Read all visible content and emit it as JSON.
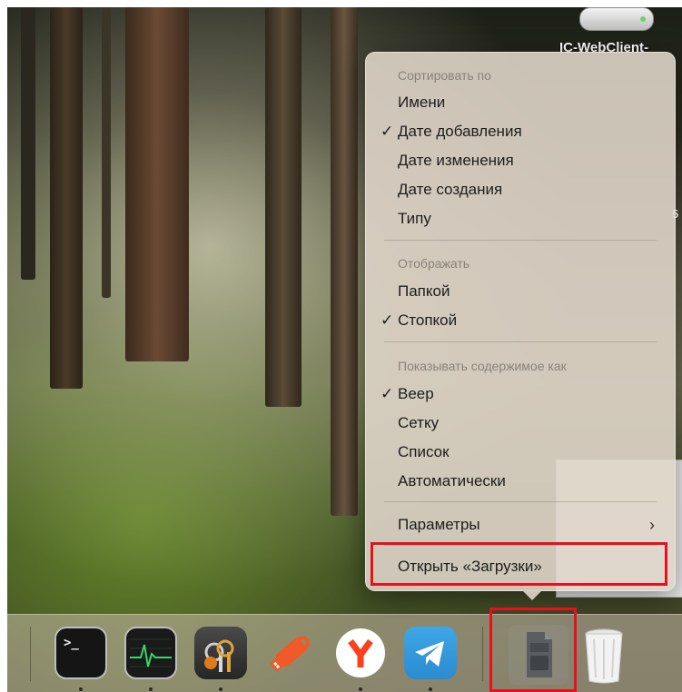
{
  "desktop": {
    "drive_label": "IC-WebClient-",
    "edge_glyph": "5"
  },
  "context_menu": {
    "sort_header": "Сортировать по",
    "sort_items": [
      {
        "label": "Имени",
        "checked": false
      },
      {
        "label": "Дате добавления",
        "checked": true
      },
      {
        "label": "Дате изменения",
        "checked": false
      },
      {
        "label": "Дате создания",
        "checked": false
      },
      {
        "label": "Типу",
        "checked": false
      }
    ],
    "display_header": "Отображать",
    "display_items": [
      {
        "label": "Папкой",
        "checked": false
      },
      {
        "label": "Стопкой",
        "checked": true
      }
    ],
    "content_header": "Показывать содержимое как",
    "content_items": [
      {
        "label": "Веер",
        "checked": true
      },
      {
        "label": "Сетку",
        "checked": false
      },
      {
        "label": "Список",
        "checked": false
      },
      {
        "label": "Автоматически",
        "checked": false
      }
    ],
    "options_label": "Параметры",
    "open_downloads_label": "Открыть «Загрузки»",
    "check_glyph": "✓",
    "submenu_glyph": "›"
  },
  "dock": {
    "apps": [
      {
        "name": "Terminal",
        "icon": "terminal-icon"
      },
      {
        "name": "Activity Monitor",
        "icon": "activity-monitor-icon"
      },
      {
        "name": "Keychain Access",
        "icon": "keychain-icon"
      },
      {
        "name": "USB",
        "icon": "usb-icon"
      },
      {
        "name": "Yandex Browser",
        "icon": "yandex-browser-icon"
      },
      {
        "name": "Telegram",
        "icon": "telegram-icon"
      },
      {
        "name": "Downloads",
        "icon": "downloads-stack-icon"
      },
      {
        "name": "Trash",
        "icon": "trash-icon"
      }
    ],
    "terminal_prompt": ">_"
  },
  "colors": {
    "highlight": "#e8101c",
    "menu_text": "#1d1d1d",
    "menu_header": "#8a8279"
  }
}
